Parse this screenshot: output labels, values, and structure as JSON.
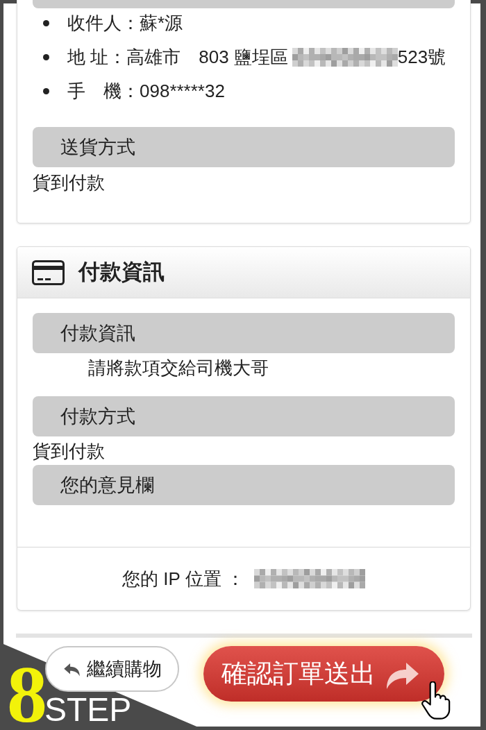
{
  "recipient_card": {
    "fields": [
      {
        "kind": "text",
        "label": "收件人：",
        "value": "蘇*源"
      },
      {
        "kind": "address",
        "label": "地 址：",
        "value": "高雄市　803 鹽埕區",
        "value_end": "523號"
      },
      {
        "kind": "text",
        "label": "手　機：",
        "value": "098*****32"
      }
    ],
    "shipping": {
      "heading": "送貨方式",
      "value": "貨到付款"
    }
  },
  "payment_card": {
    "title": "付款資訊",
    "sections": [
      {
        "kind": "indented",
        "heading": "付款資訊",
        "value": "請將款項交給司機大哥"
      },
      {
        "kind": "plain",
        "heading": "付款方式",
        "value": "貨到付款"
      },
      {
        "kind": "plain",
        "heading": "您的意見欄"
      }
    ]
  },
  "ip_row": {
    "label": "您的 IP 位置 ："
  },
  "buttons": [
    {
      "kind": "secondary",
      "label": "繼續購物"
    },
    {
      "kind": "primary",
      "label": "確認訂單送出"
    }
  ],
  "step_badge": {
    "number": "8",
    "label": "STEP"
  }
}
